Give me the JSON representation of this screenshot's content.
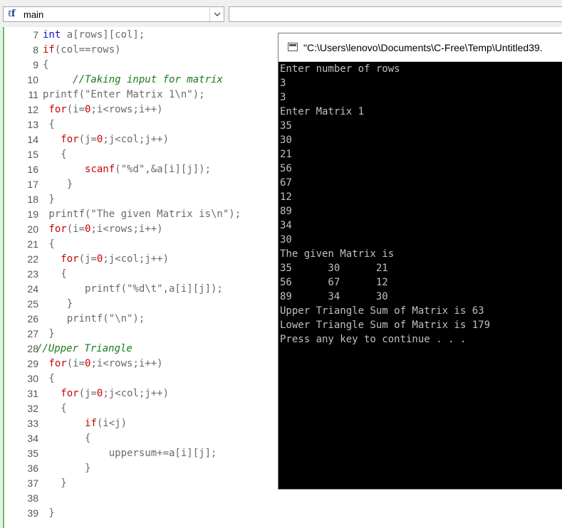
{
  "toolbar": {
    "function_icon": "function-icon",
    "function_name": "main",
    "dropdown_icon": "chevron-down-icon",
    "second_combo_value": ""
  },
  "editor": {
    "lines": [
      {
        "n": "7",
        "tokens": [
          {
            "t": "int ",
            "c": "kw"
          },
          {
            "t": "a[rows][col];",
            "c": ""
          }
        ]
      },
      {
        "n": "8",
        "tokens": [
          {
            "t": "if",
            "c": "red"
          },
          {
            "t": "(col==rows)",
            "c": ""
          }
        ]
      },
      {
        "n": "9",
        "tokens": [
          {
            "t": "{",
            "c": ""
          }
        ]
      },
      {
        "n": "10",
        "tokens": [
          {
            "t": "     //Taking input for matrix",
            "c": "cm"
          }
        ]
      },
      {
        "n": "11",
        "tokens": [
          {
            "t": "printf(\"Enter Matrix 1\\n\");",
            "c": ""
          }
        ]
      },
      {
        "n": "12",
        "tokens": [
          {
            "t": " ",
            "c": ""
          },
          {
            "t": "for",
            "c": "red"
          },
          {
            "t": "(i=",
            "c": ""
          },
          {
            "t": "0",
            "c": "num"
          },
          {
            "t": ";i<rows;i++)",
            "c": ""
          }
        ]
      },
      {
        "n": "13",
        "tokens": [
          {
            "t": " {",
            "c": ""
          }
        ]
      },
      {
        "n": "14",
        "tokens": [
          {
            "t": "   ",
            "c": ""
          },
          {
            "t": "for",
            "c": "red"
          },
          {
            "t": "(j=",
            "c": ""
          },
          {
            "t": "0",
            "c": "num"
          },
          {
            "t": ";j<col;j++)",
            "c": ""
          }
        ]
      },
      {
        "n": "15",
        "tokens": [
          {
            "t": "   {",
            "c": ""
          }
        ]
      },
      {
        "n": "16",
        "tokens": [
          {
            "t": "       ",
            "c": ""
          },
          {
            "t": "scanf",
            "c": "red"
          },
          {
            "t": "(\"%d\",&a[i][j]);",
            "c": ""
          }
        ]
      },
      {
        "n": "17",
        "tokens": [
          {
            "t": "    }",
            "c": ""
          }
        ]
      },
      {
        "n": "18",
        "tokens": [
          {
            "t": " }",
            "c": ""
          }
        ]
      },
      {
        "n": "19",
        "tokens": [
          {
            "t": " printf(\"The given Matrix is\\n\");",
            "c": ""
          }
        ]
      },
      {
        "n": "20",
        "tokens": [
          {
            "t": " ",
            "c": ""
          },
          {
            "t": "for",
            "c": "red"
          },
          {
            "t": "(i=",
            "c": ""
          },
          {
            "t": "0",
            "c": "num"
          },
          {
            "t": ";i<rows;i++)",
            "c": ""
          }
        ]
      },
      {
        "n": "21",
        "tokens": [
          {
            "t": " {",
            "c": ""
          }
        ]
      },
      {
        "n": "22",
        "tokens": [
          {
            "t": "   ",
            "c": ""
          },
          {
            "t": "for",
            "c": "red"
          },
          {
            "t": "(j=",
            "c": ""
          },
          {
            "t": "0",
            "c": "num"
          },
          {
            "t": ";j<col;j++)",
            "c": ""
          }
        ]
      },
      {
        "n": "23",
        "tokens": [
          {
            "t": "   {",
            "c": ""
          }
        ]
      },
      {
        "n": "24",
        "tokens": [
          {
            "t": "       printf(\"%d\\t\",a[i][j]);",
            "c": ""
          }
        ]
      },
      {
        "n": "25",
        "tokens": [
          {
            "t": "    }",
            "c": ""
          }
        ]
      },
      {
        "n": "26",
        "tokens": [
          {
            "t": "    printf(\"\\n\");",
            "c": ""
          }
        ]
      },
      {
        "n": "27",
        "tokens": [
          {
            "t": " }",
            "c": ""
          }
        ]
      },
      {
        "n": "28",
        "tokens": [
          {
            "t": "//Upper Triangle",
            "c": "cm"
          }
        ],
        "shift": -9
      },
      {
        "n": "29",
        "tokens": [
          {
            "t": " ",
            "c": ""
          },
          {
            "t": "for",
            "c": "red"
          },
          {
            "t": "(i=",
            "c": ""
          },
          {
            "t": "0",
            "c": "num"
          },
          {
            "t": ";i<rows;i++)",
            "c": ""
          }
        ]
      },
      {
        "n": "30",
        "tokens": [
          {
            "t": " {",
            "c": ""
          }
        ]
      },
      {
        "n": "31",
        "tokens": [
          {
            "t": "   ",
            "c": ""
          },
          {
            "t": "for",
            "c": "red"
          },
          {
            "t": "(j=",
            "c": ""
          },
          {
            "t": "0",
            "c": "num"
          },
          {
            "t": ";j<col;j++)",
            "c": ""
          }
        ]
      },
      {
        "n": "32",
        "tokens": [
          {
            "t": "   {",
            "c": ""
          }
        ]
      },
      {
        "n": "33",
        "tokens": [
          {
            "t": "       ",
            "c": ""
          },
          {
            "t": "if",
            "c": "red"
          },
          {
            "t": "(i<j)",
            "c": ""
          }
        ]
      },
      {
        "n": "34",
        "tokens": [
          {
            "t": "       {",
            "c": ""
          }
        ]
      },
      {
        "n": "35",
        "tokens": [
          {
            "t": "           uppersum+=a[i][j];",
            "c": ""
          }
        ]
      },
      {
        "n": "36",
        "tokens": [
          {
            "t": "       }",
            "c": ""
          }
        ]
      },
      {
        "n": "37",
        "tokens": [
          {
            "t": "   }",
            "c": ""
          }
        ]
      },
      {
        "n": "38",
        "tokens": [
          {
            "t": "",
            "c": ""
          }
        ]
      },
      {
        "n": "39",
        "tokens": [
          {
            "t": " }",
            "c": ""
          }
        ]
      }
    ]
  },
  "console": {
    "title": "\"C:\\Users\\lenovo\\Documents\\C-Free\\Temp\\Untitled39.",
    "icon": "console-window-icon",
    "output": [
      "Enter number of rows",
      "3",
      "3",
      "Enter Matrix 1",
      "35",
      "30",
      "21",
      "56",
      "67",
      "12",
      "89",
      "34",
      "30",
      "The given Matrix is",
      "35      30      21",
      "56      67      12",
      "89      34      30",
      "Upper Triangle Sum of Matrix is 63",
      "Lower Triangle Sum of Matrix is 179",
      "Press any key to continue . . ."
    ]
  },
  "colors": {
    "keyword": "#1111cc",
    "keyword_red": "#cc0000",
    "comment": "#1a7a1a",
    "code_default": "#6a6a6a",
    "console_bg": "#000000",
    "console_text": "#c0c0c0",
    "change_bar": "#5ac85a"
  }
}
